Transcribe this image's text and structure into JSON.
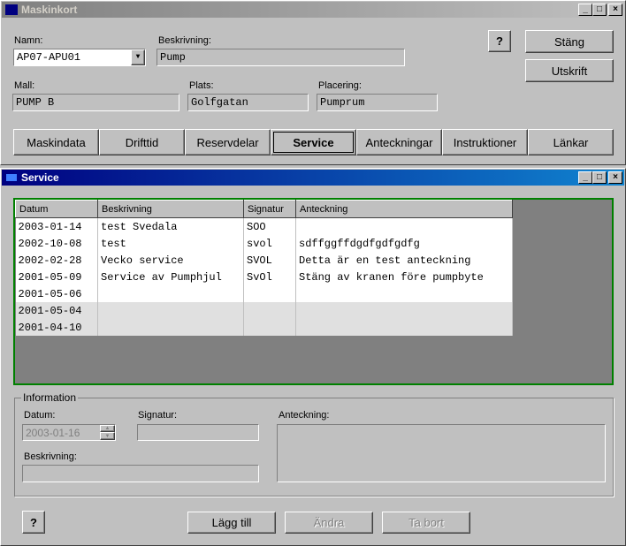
{
  "main_window": {
    "title": "Maskinkort",
    "labels": {
      "namn": "Namn:",
      "beskrivning": "Beskrivning:",
      "mall": "Mall:",
      "plats": "Plats:",
      "placering": "Placering:"
    },
    "values": {
      "namn": "AP07-APU01",
      "beskrivning": "Pump",
      "mall": "PUMP B",
      "plats": "Golfgatan",
      "placering": "Pumprum"
    },
    "help": "?",
    "close": "Stäng",
    "print": "Utskrift",
    "tabs": [
      "Maskindata",
      "Drifttid",
      "Reservdelar",
      "Service",
      "Anteckningar",
      "Instruktioner",
      "Länkar"
    ],
    "active_tab": "Service"
  },
  "service_window": {
    "title": "Service",
    "columns": [
      "Datum",
      "Beskrivning",
      "Signatur",
      "Anteckning"
    ],
    "rows": [
      [
        "2003-01-14",
        "test Svedala",
        "SOO",
        ""
      ],
      [
        "2002-10-08",
        "test",
        "svol",
        "sdffggffdgdfgdfgdfg"
      ],
      [
        "2002-02-28",
        "Vecko service",
        "SVOL",
        "Detta är en test anteckning"
      ],
      [
        "2001-05-09",
        "Service av Pumphjul",
        "SvOl",
        "Stäng av kranen före pumpbyte"
      ],
      [
        "2001-05-06",
        "",
        "",
        ""
      ],
      [
        "2001-05-04",
        "",
        "",
        ""
      ],
      [
        "2001-04-10",
        "",
        "",
        ""
      ]
    ],
    "info": {
      "group": "Information",
      "datum_label": "Datum:",
      "datum_value": "2003-01-16",
      "signatur_label": "Signatur:",
      "anteckning_label": "Anteckning:",
      "beskrivning_label": "Beskrivning:"
    },
    "help": "?",
    "add": "Lägg till",
    "edit": "Ändra",
    "delete": "Ta bort"
  },
  "colors": {
    "active_title": "#000080",
    "inactive_title": "#808080",
    "grid_border": "#008000"
  }
}
